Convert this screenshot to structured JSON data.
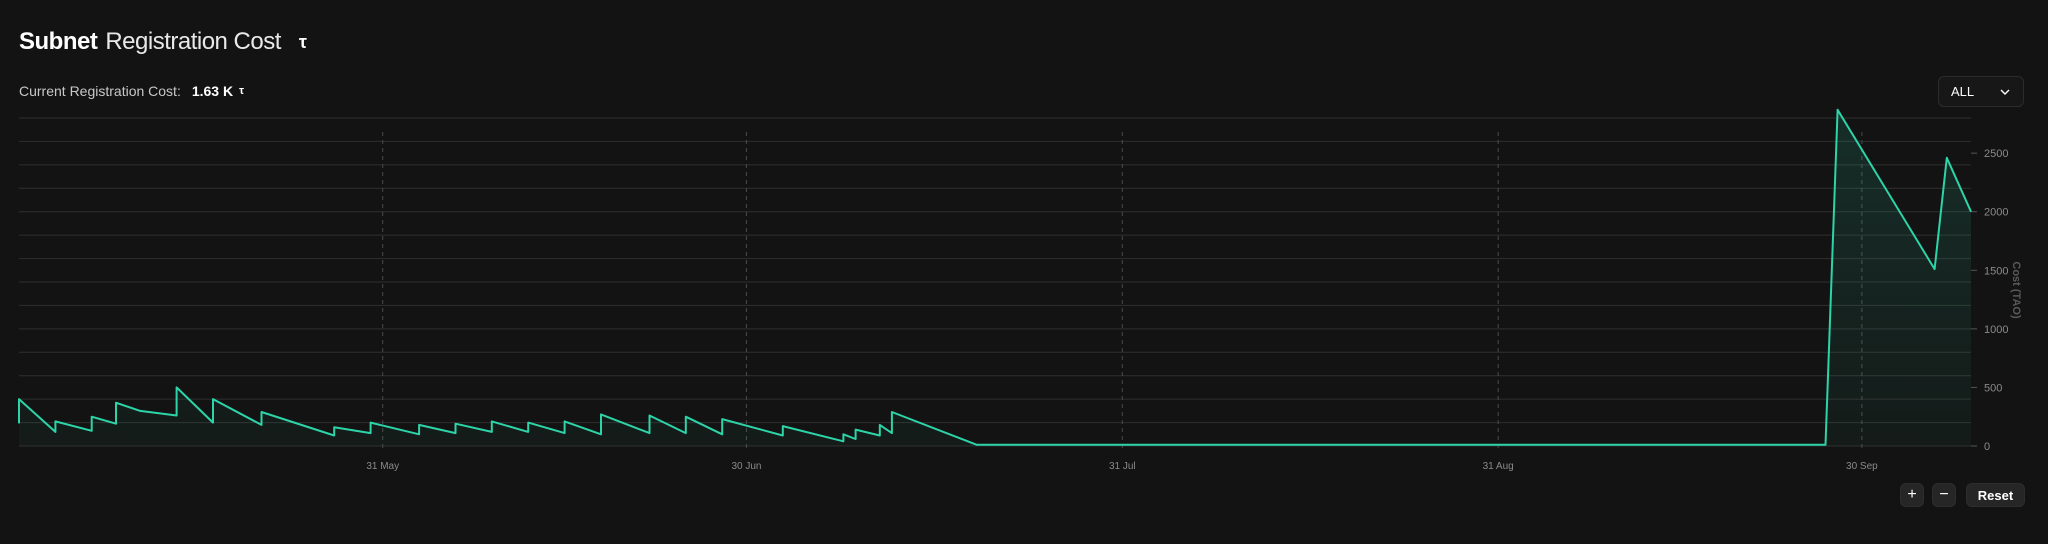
{
  "header": {
    "title_bold": "Subnet",
    "title_light": "Registration Cost",
    "title_symbol": "τ"
  },
  "current": {
    "label": "Current Registration Cost:",
    "value": "1.63 K",
    "unit": "τ"
  },
  "range_select": {
    "value": "ALL"
  },
  "controls": {
    "zoom_in": "+",
    "zoom_out": "−",
    "reset": "Reset"
  },
  "colors": {
    "line": "#2dd4a8",
    "background": "#131313",
    "grid": "#2f2f2f",
    "tick": "#8a8a8a"
  },
  "chart_data": {
    "type": "area",
    "ylabel": "Cost (TAO)",
    "xlim": [
      "2025-05-01",
      "2025-10-09"
    ],
    "ylim": [
      0,
      2800
    ],
    "y_ticks": [
      0,
      500,
      1000,
      1500,
      2000,
      2500
    ],
    "x_ticks": [
      {
        "date": "2025-05-31",
        "label": "31 May"
      },
      {
        "date": "2025-06-30",
        "label": "30 Jun"
      },
      {
        "date": "2025-07-31",
        "label": "31 Jul"
      },
      {
        "date": "2025-08-31",
        "label": "31 Aug"
      },
      {
        "date": "2025-09-30",
        "label": "30 Sep"
      }
    ],
    "grid": {
      "horizontal": true,
      "vertical_dashed_at_ticks": true
    },
    "series": [
      {
        "values": [
          [
            "2025-05-01",
            400
          ],
          [
            "2025-05-01",
            200
          ],
          [
            "2025-05-01",
            400
          ],
          [
            "2025-05-04",
            120
          ],
          [
            "2025-05-04",
            210
          ],
          [
            "2025-05-07",
            130
          ],
          [
            "2025-05-07",
            250
          ],
          [
            "2025-05-09",
            190
          ],
          [
            "2025-05-09",
            370
          ],
          [
            "2025-05-11",
            300
          ],
          [
            "2025-05-14",
            260
          ],
          [
            "2025-05-14",
            500
          ],
          [
            "2025-05-17",
            200
          ],
          [
            "2025-05-17",
            400
          ],
          [
            "2025-05-21",
            180
          ],
          [
            "2025-05-21",
            290
          ],
          [
            "2025-05-27",
            90
          ],
          [
            "2025-05-27",
            160
          ],
          [
            "2025-05-30",
            110
          ],
          [
            "2025-05-30",
            200
          ],
          [
            "2025-06-03",
            100
          ],
          [
            "2025-06-03",
            180
          ],
          [
            "2025-06-06",
            110
          ],
          [
            "2025-06-06",
            190
          ],
          [
            "2025-06-09",
            120
          ],
          [
            "2025-06-09",
            210
          ],
          [
            "2025-06-12",
            120
          ],
          [
            "2025-06-12",
            200
          ],
          [
            "2025-06-15",
            110
          ],
          [
            "2025-06-15",
            210
          ],
          [
            "2025-06-18",
            100
          ],
          [
            "2025-06-18",
            270
          ],
          [
            "2025-06-22",
            110
          ],
          [
            "2025-06-22",
            260
          ],
          [
            "2025-06-25",
            110
          ],
          [
            "2025-06-25",
            250
          ],
          [
            "2025-06-28",
            100
          ],
          [
            "2025-06-28",
            230
          ],
          [
            "2025-07-03",
            90
          ],
          [
            "2025-07-03",
            170
          ],
          [
            "2025-07-08",
            40
          ],
          [
            "2025-07-08",
            100
          ],
          [
            "2025-07-09",
            60
          ],
          [
            "2025-07-09",
            140
          ],
          [
            "2025-07-11",
            90
          ],
          [
            "2025-07-11",
            180
          ],
          [
            "2025-07-12",
            110
          ],
          [
            "2025-07-12",
            290
          ],
          [
            "2025-07-19",
            10
          ],
          [
            "2025-09-27",
            10
          ],
          [
            "2025-09-28",
            2870
          ],
          [
            "2025-10-06",
            1510
          ],
          [
            "2025-10-07",
            2460
          ],
          [
            "2025-10-09",
            2000
          ]
        ]
      }
    ]
  }
}
